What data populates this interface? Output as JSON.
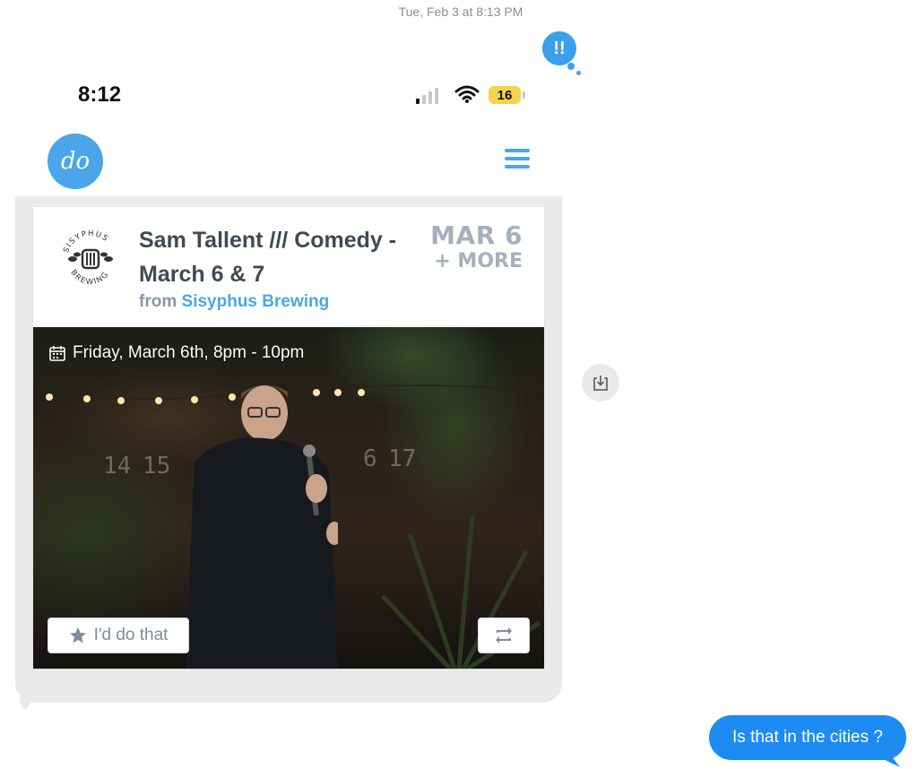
{
  "conversation": {
    "timestamp": "Tue, Feb 3 at 8:13 PM",
    "tapback_glyph": "!!",
    "outgoing_message": "Is that in the cities ?"
  },
  "screenshot": {
    "status_bar": {
      "time": "8:12",
      "battery": "16",
      "battery_color": "#f6d34c"
    },
    "app": {
      "logo_text": "do",
      "brand_color": "#4aa6e8"
    },
    "event": {
      "venue_logo_text_top": "SISYPHUS",
      "venue_logo_text_bottom": "BREWING",
      "title": "Sam Tallent /// Comedy - March 6 & 7",
      "from_prefix": "from",
      "venue": "Sisyphus Brewing",
      "date_badge": "MAR 6",
      "date_more": "+ MORE",
      "datetime": "Friday, March 6th, 8pm - 10pm",
      "fence_numbers": [
        "14",
        "15",
        "6",
        "17"
      ],
      "action_label": "I'd do that"
    }
  },
  "colors": {
    "imessage_blue": "#1c8cf2",
    "bubble_gray": "#e9eaec"
  }
}
